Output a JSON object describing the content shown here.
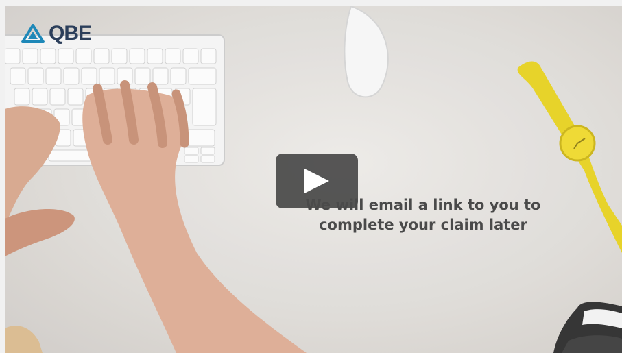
{
  "brand": {
    "name": "QBE",
    "mark_color": "#1e88b8",
    "text_color": "#2b3e5a"
  },
  "video": {
    "caption_line1": "We will email a link to you to",
    "caption_line2": "complete your claim later",
    "play_icon": "play-icon"
  }
}
